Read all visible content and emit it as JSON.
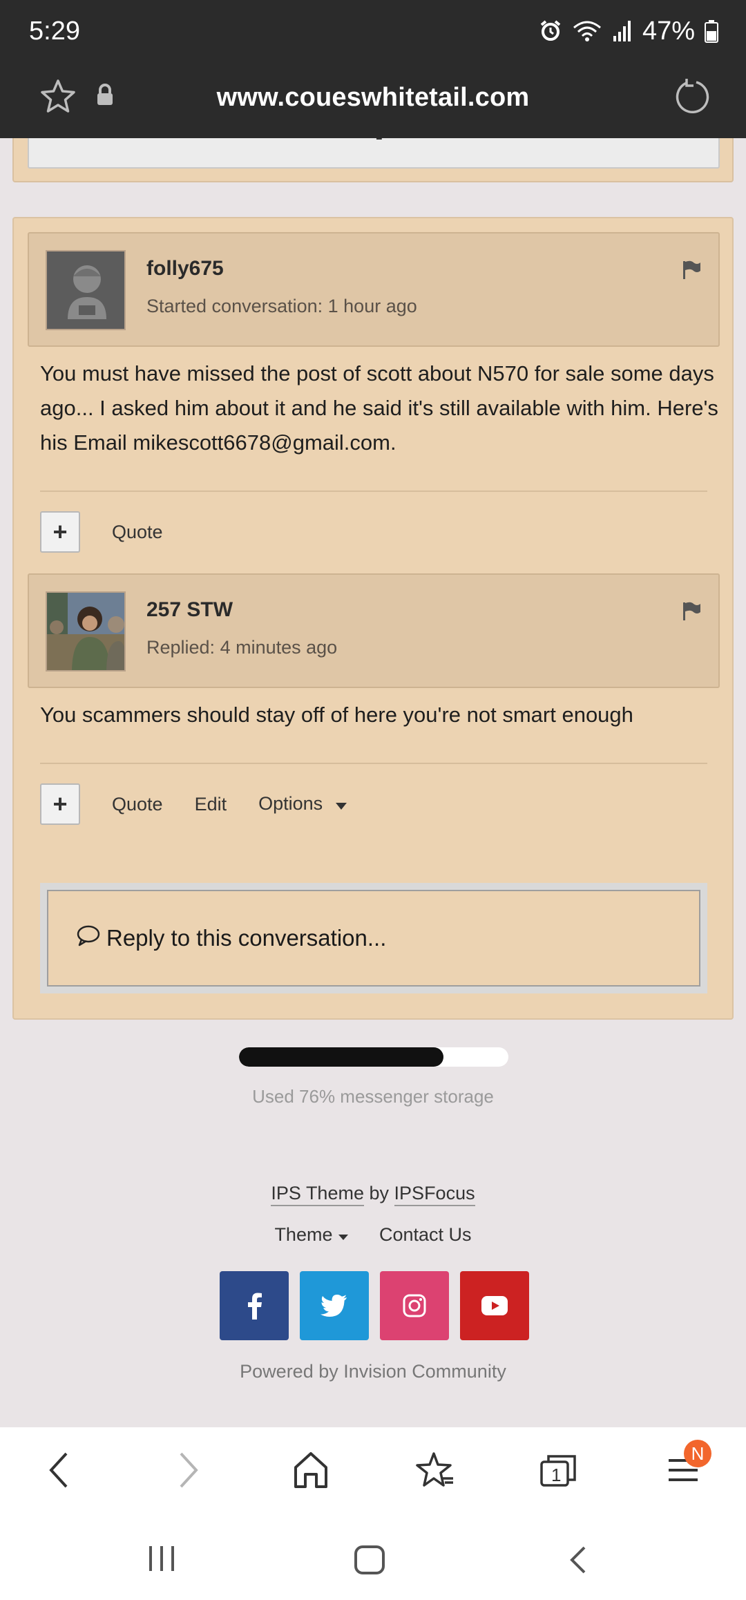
{
  "status_bar": {
    "time": "5:29",
    "battery": "47%"
  },
  "url_bar": {
    "url": "www.coueswhitetail.com"
  },
  "messages": [
    {
      "author": "folly675",
      "meta": "Started conversation: 1 hour ago",
      "body": "You must have missed the post of scott about N570 for sale some days ago... I asked him about it and he said it's still available with him. Here's his Email mikescott6678@gmail.com.",
      "actions": [
        "Quote"
      ]
    },
    {
      "author": "257 STW",
      "meta": "Replied: 4 minutes ago",
      "body": "You scammers should stay off of here you're not smart enough",
      "actions": [
        "Quote",
        "Edit",
        "Options"
      ]
    }
  ],
  "reply_prompt": "Reply to this conversation...",
  "storage": {
    "text": "Used 76% messenger storage",
    "fraction": 0.76
  },
  "footer": {
    "theme_link": "IPS Theme",
    "by": "by",
    "focus_link": "IPSFocus",
    "theme_menu": "Theme",
    "contact": "Contact Us",
    "powered": "Powered by Invision Community",
    "social_colors": {
      "facebook": "#2d4a8a",
      "twitter": "#1f98d8",
      "instagram": "#dc4271",
      "youtube": "#cc2222"
    }
  },
  "toolbar": {
    "menu_badge": "N",
    "tabs_count": "1"
  }
}
